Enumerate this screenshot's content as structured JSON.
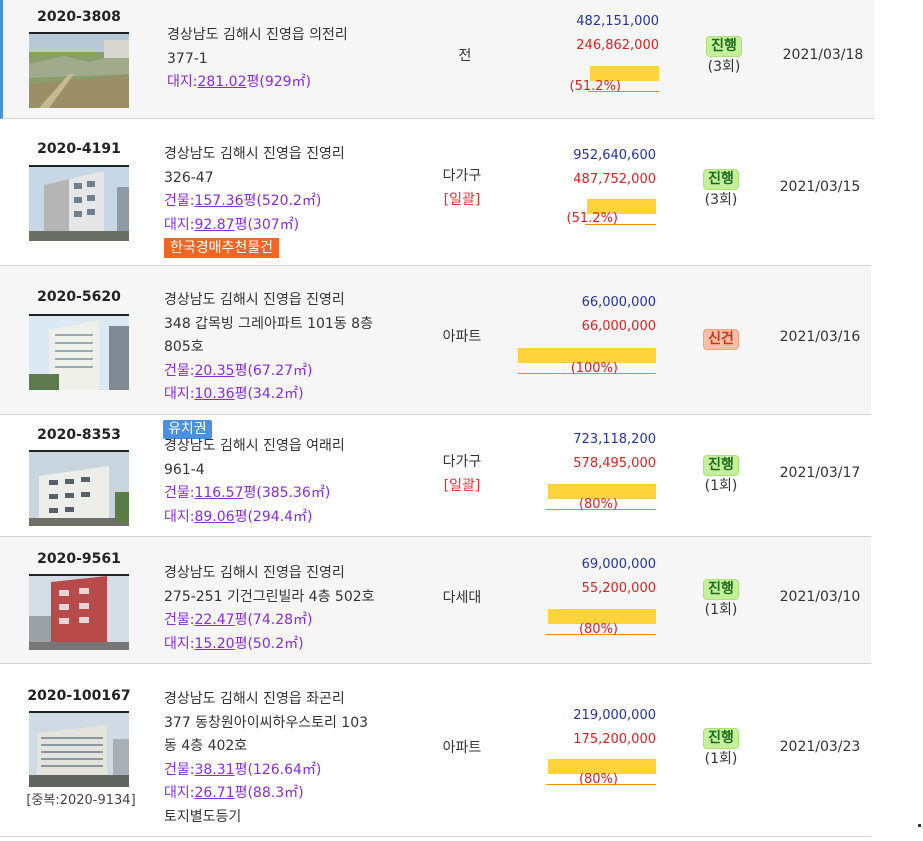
{
  "listings": [
    {
      "case_no": "2020-3808",
      "address_lines": [
        "경상남도 김해시 진영읍 의전리",
        "377-1"
      ],
      "land_label": "대지:",
      "land_pyeong": "281.02",
      "land_unit": "평",
      "land_sqm": "(929㎡)",
      "type": "전",
      "appraisal": "482,151,000",
      "minimum": "246,862,000",
      "ratio": "(51.2%)",
      "ratio_value": 0.512,
      "status": "진행",
      "count": "(3회)",
      "date": "2021/03/18"
    },
    {
      "case_no": "2020-4191",
      "address_lines": [
        "경상남도 김해시 진영읍 진영리",
        "326-47"
      ],
      "building_label": "건물:",
      "building_pyeong": "157.36",
      "building_unit": "평",
      "building_sqm": "(520.2㎡)",
      "land_label": "대지:",
      "land_pyeong": "92.87",
      "land_unit": "평",
      "land_sqm": "(307㎡)",
      "recommend_badge": "한국경매추천물건",
      "type": "다가구",
      "type_note": "[일괄]",
      "appraisal": "952,640,600",
      "minimum": "487,752,000",
      "ratio": "(51.2%)",
      "ratio_value": 0.512,
      "status": "진행",
      "count": "(3회)",
      "date": "2021/03/15"
    },
    {
      "case_no": "2020-5620",
      "address_lines": [
        "경상남도 김해시 진영읍 진영리",
        "348 갑목빙 그레아파트 101동 8층",
        "805호"
      ],
      "building_label": "건물:",
      "building_pyeong": "20.35",
      "building_unit": "평",
      "building_sqm": "(67.27㎡)",
      "land_label": "대지:",
      "land_pyeong": "10.36",
      "land_unit": "평",
      "land_sqm": "(34.2㎡)",
      "type": "아파트",
      "appraisal": "66,000,000",
      "minimum": "66,000,000",
      "ratio": "(100%)",
      "ratio_value": 1.0,
      "status": "신건",
      "count": "",
      "date": "2021/03/16"
    },
    {
      "case_no": "2020-8353",
      "lien_badge": "유치권",
      "address_lines": [
        "경상남도 김해시 진영읍 여래리",
        "961-4"
      ],
      "building_label": "건물:",
      "building_pyeong": "116.57",
      "building_unit": "평",
      "building_sqm": "(385.36㎡)",
      "land_label": "대지:",
      "land_pyeong": "89.06",
      "land_unit": "평",
      "land_sqm": "(294.4㎡)",
      "type": "다가구",
      "type_note": "[일괄]",
      "appraisal": "723,118,200",
      "minimum": "578,495,000",
      "ratio": "(80%)",
      "ratio_value": 0.8,
      "status": "진행",
      "count": "(1회)",
      "date": "2021/03/17"
    },
    {
      "case_no": "2020-9561",
      "address_lines": [
        "경상남도 김해시 진영읍 진영리",
        "275-251 기건그린빌라 4층 502호"
      ],
      "building_label": "건물:",
      "building_pyeong": "22.47",
      "building_unit": "평",
      "building_sqm": "(74.28㎡)",
      "land_label": "대지:",
      "land_pyeong": "15.20",
      "land_unit": "평",
      "land_sqm": "(50.2㎡)",
      "type": "다세대",
      "appraisal": "69,000,000",
      "minimum": "55,200,000",
      "ratio": "(80%)",
      "ratio_value": 0.8,
      "status": "진행",
      "count": "(1회)",
      "date": "2021/03/10"
    },
    {
      "case_no": "2020-100167",
      "duplicate": "[중복:2020-9134]",
      "address_lines": [
        "경상남도 김해시 진영읍 좌곤리",
        "377 동창원아이씨하우스토리 103",
        "동 4층 402호"
      ],
      "building_label": "건물:",
      "building_pyeong": "38.31",
      "building_unit": "평",
      "building_sqm": "(126.64㎡)",
      "land_label": "대지:",
      "land_pyeong": "26.71",
      "land_unit": "평",
      "land_sqm": "(88.3㎡)",
      "memo": "토지별도등기",
      "type": "아파트",
      "appraisal": "219,000,000",
      "minimum": "175,200,000",
      "ratio": "(80%)",
      "ratio_value": 0.8,
      "status": "진행",
      "count": "(1회)",
      "date": "2021/03/23"
    }
  ],
  "colors": {
    "appraisal": "#2233aa",
    "minimum": "#e02020",
    "status_progress": "#c5f09a",
    "status_new": "#ffbfa6",
    "ratio_bar": "#ffd43b"
  }
}
